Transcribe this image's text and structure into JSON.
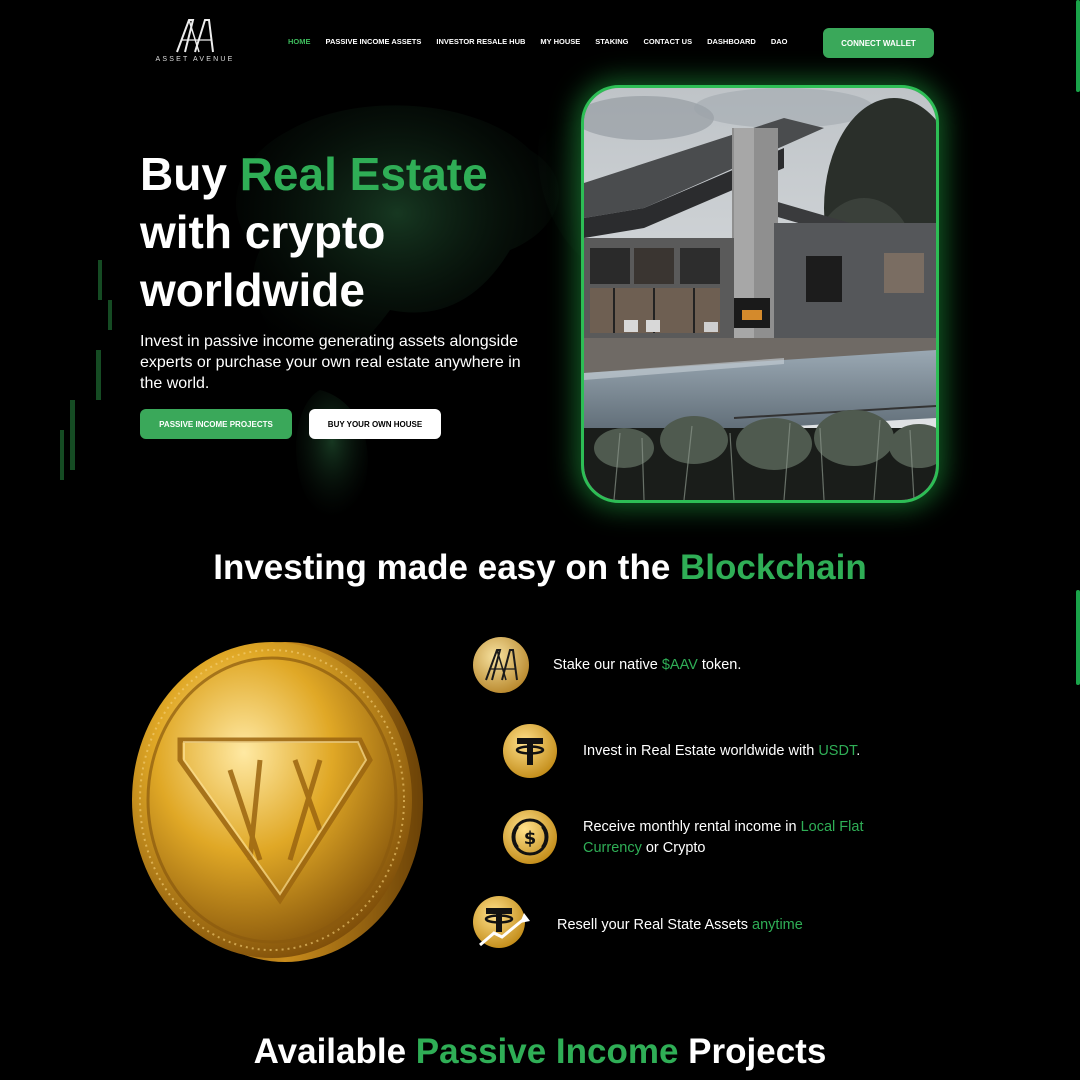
{
  "brand": {
    "logo_text": "ASSET AVENUE"
  },
  "nav": {
    "items": [
      "HOME",
      "PASSIVE INCOME ASSETS",
      "INVESTOR RESALE HUB",
      "MY HOUSE",
      "STAKING",
      "CONTACT US",
      "DASHBOARD",
      "DAO"
    ],
    "connect_label": "CONNECT WALLET"
  },
  "hero": {
    "title_part1": "Buy ",
    "title_highlight": "Real Estate",
    "title_part2": "with crypto worldwide",
    "subtitle": "Invest in passive income generating assets alongside experts or purchase your own real estate anywhere in the world.",
    "btn_primary": "PASSIVE INCOME PROJECTS",
    "btn_secondary": "BUY YOUR OWN HOUSE"
  },
  "blockchain": {
    "title_part1": "Investing made easy on the ",
    "title_highlight": "Blockchain",
    "features": [
      {
        "icon": "aav-token-icon",
        "text_before": "Stake our native ",
        "highlight": "$AAV",
        "text_after": " token."
      },
      {
        "icon": "tether-icon",
        "text_before": "Invest in Real Estate worldwide with ",
        "highlight": "USDT",
        "text_after": "."
      },
      {
        "icon": "usdc-icon",
        "text_before": "Receive monthly rental income in ",
        "highlight": "Local Flat Currency",
        "text_after": " or Crypto"
      },
      {
        "icon": "tether-growth-icon",
        "text_before": "Resell your Real State Assets ",
        "highlight": "anytime",
        "text_after": ""
      }
    ]
  },
  "projects": {
    "title_part1": "Available ",
    "title_highlight": "Passive Income",
    "title_part2": " Projects"
  },
  "colors": {
    "accent": "#3aa85a",
    "highlight_text": "#2fae56",
    "background": "#000000",
    "glow": "#2dbe55"
  }
}
